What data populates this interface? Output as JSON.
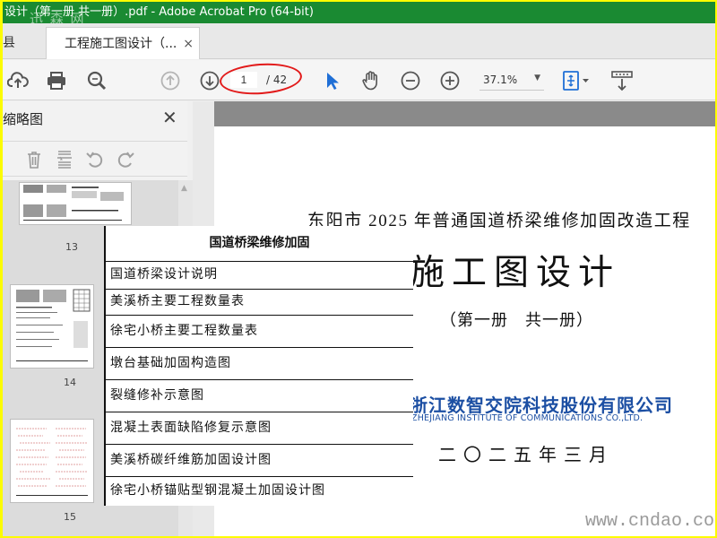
{
  "window": {
    "title": "设计（第一册 共一册）.pdf - Adobe Acrobat Pro (64-bit)"
  },
  "tabs": {
    "home_label": "县",
    "active_label": "工程施工图设计（...",
    "close_glyph": "×"
  },
  "toolbar": {
    "icons": [
      "upload-icon",
      "print-icon",
      "magnify-icon",
      "page-up-icon",
      "page-down-icon",
      "select-arrow-icon",
      "hand-icon",
      "zoom-out-icon",
      "zoom-in-icon",
      "fit-page-icon",
      "scroll-mode-icon"
    ],
    "page_current": "1",
    "page_total": "/ 42",
    "zoom_value": "37.1%",
    "zoom_arrow": "▼",
    "accent": "#e21a1a"
  },
  "sidebar": {
    "title": "缩略图",
    "close_glyph": "✕",
    "tools": [
      "delete-icon",
      "extract-icon",
      "undo-icon",
      "redo-icon"
    ],
    "thumbnails": [
      {
        "number": "13"
      },
      {
        "number": "14"
      },
      {
        "number": "15"
      }
    ]
  },
  "document": {
    "line1": "东阳市 2025 年普通国道桥梁维修加固改造工程",
    "line2": "施工图设计",
    "line3": "（第一册　共一册）",
    "company_cn": "浙江数智交院科技股份有限公司",
    "company_en": "ZHEJIANG  INSTITUTE  OF COMMUNICATIONS CO.,LTD.",
    "date": "二〇二五年三月",
    "company_color": "#1c4fa3"
  },
  "toc": {
    "header": "国道桥梁维修加固",
    "items": [
      "国道桥梁设计说明",
      "美溪桥主要工程数量表",
      "徐宅小桥主要工程数量表",
      "墩台基础加固构造图",
      "裂缝修补示意图",
      "混凝土表面缺陷修复示意图",
      "美溪桥碳纤维筋加固设计图",
      "徐宅小桥锚贴型钢混凝土加固设计图"
    ]
  },
  "watermarks": {
    "top_left": "迅 森 网",
    "bottom_right": "www.cndao.com"
  }
}
